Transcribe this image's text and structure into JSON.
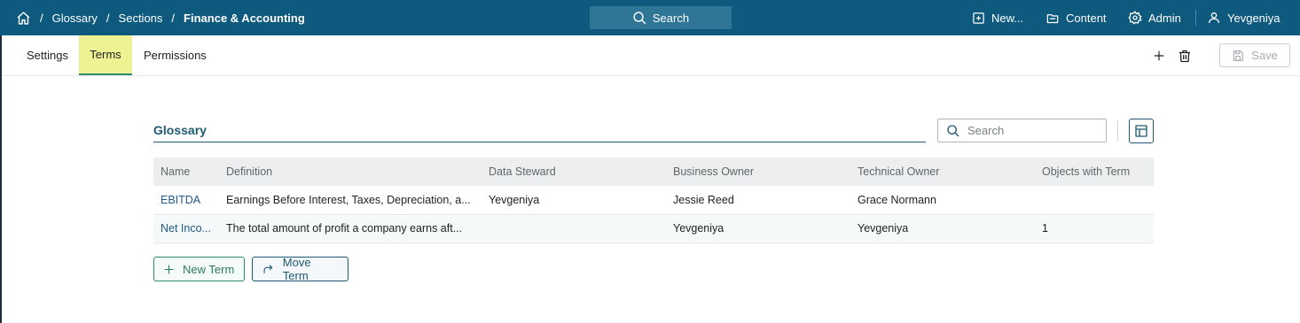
{
  "topbar": {
    "breadcrumb": [
      "Glossary",
      "Sections",
      "Finance & Accounting"
    ],
    "search_label": "Search",
    "new_label": "New...",
    "content_label": "Content",
    "admin_label": "Admin",
    "user_label": "Yevgeniya",
    "bg_color": "#0e5a7e"
  },
  "tabs": [
    "Settings",
    "Terms",
    "Permissions"
  ],
  "active_tab": "Terms",
  "toolbar": {
    "save_label": "Save"
  },
  "glossary": {
    "title": "Glossary",
    "search_placeholder": "Search",
    "columns": [
      "Name",
      "Definition",
      "Data Steward",
      "Business Owner",
      "Technical Owner",
      "Objects with Term"
    ],
    "rows": [
      [
        "EBITDA",
        "Earnings Before Interest, Taxes, Depreciation, a...",
        "Yevgeniya",
        "Jessie Reed",
        "Grace Normann",
        ""
      ],
      [
        "Net Inco...",
        "The total amount of profit a company earns aft...",
        "",
        "Yevgeniya",
        "Yevgeniya",
        "1"
      ]
    ],
    "new_term_label": "New Term",
    "move_term_label": "Move Term"
  },
  "icons": [
    "home-icon",
    "search-icon",
    "plus-square-icon",
    "folder-icon",
    "gear-icon",
    "user-icon",
    "plus-icon",
    "trash-icon",
    "save-icon",
    "layout-icon",
    "redo-arrow-icon"
  ]
}
